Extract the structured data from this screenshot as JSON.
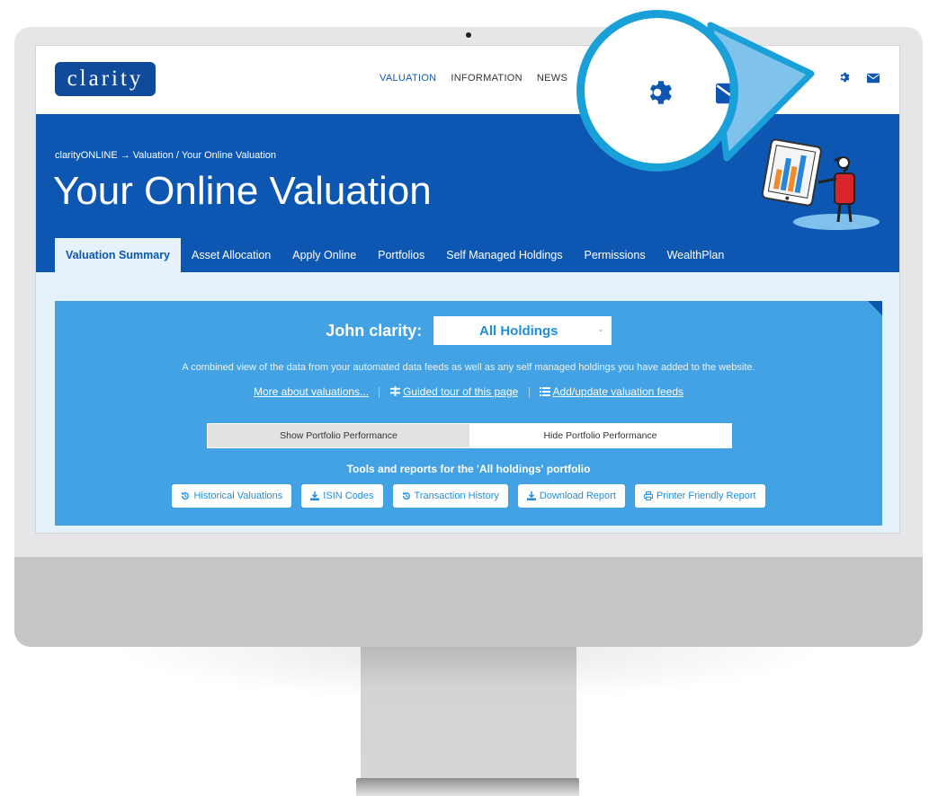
{
  "app": {
    "logo_text": "clarity"
  },
  "nav": {
    "items": [
      {
        "label": "VALUATION",
        "active": true
      },
      {
        "label": "INFORMATION",
        "active": false
      },
      {
        "label": "NEWS",
        "active": false
      }
    ],
    "icons": [
      "gear-icon",
      "mail-icon"
    ]
  },
  "hero": {
    "breadcrumb": "clarityONLINE →  Valuation  /  Your Online Valuation",
    "title": "Your Online Valuation"
  },
  "tabs": [
    {
      "label": "Valuation Summary",
      "active": true
    },
    {
      "label": "Asset Allocation",
      "active": false
    },
    {
      "label": "Apply Online",
      "active": false
    },
    {
      "label": "Portfolios",
      "active": false
    },
    {
      "label": "Self Managed Holdings",
      "active": false
    },
    {
      "label": "Permissions",
      "active": false
    },
    {
      "label": "WealthPlan",
      "active": false
    }
  ],
  "panel": {
    "owner_label": "John clarity:",
    "holdings_select": {
      "selected": "All Holdings"
    },
    "description": "A combined view of the data from your automated data feeds as well as any self managed holdings you have added to the website.",
    "links": {
      "more": "More about valuations...",
      "tour": "Guided tour of this page",
      "feeds": "Add/update valuation feeds"
    },
    "performance": {
      "show_label": "Show Portfolio Performance",
      "hide_label": "Hide Portfolio Performance"
    },
    "tools_heading": "Tools and reports for the 'All holdings' portfolio",
    "tools": [
      {
        "label": "Historical Valuations",
        "icon": "history-icon"
      },
      {
        "label": "ISIN Codes",
        "icon": "download-icon"
      },
      {
        "label": "Transaction History",
        "icon": "history-icon"
      },
      {
        "label": "Download Report",
        "icon": "download-icon"
      },
      {
        "label": "Printer Friendly Report",
        "icon": "print-icon"
      }
    ]
  },
  "colors": {
    "brand_blue": "#0d57b2",
    "panel_blue": "#42a2e3",
    "light_bg": "#e5f1fb",
    "magnifier_ring": "#1aa0d8"
  }
}
